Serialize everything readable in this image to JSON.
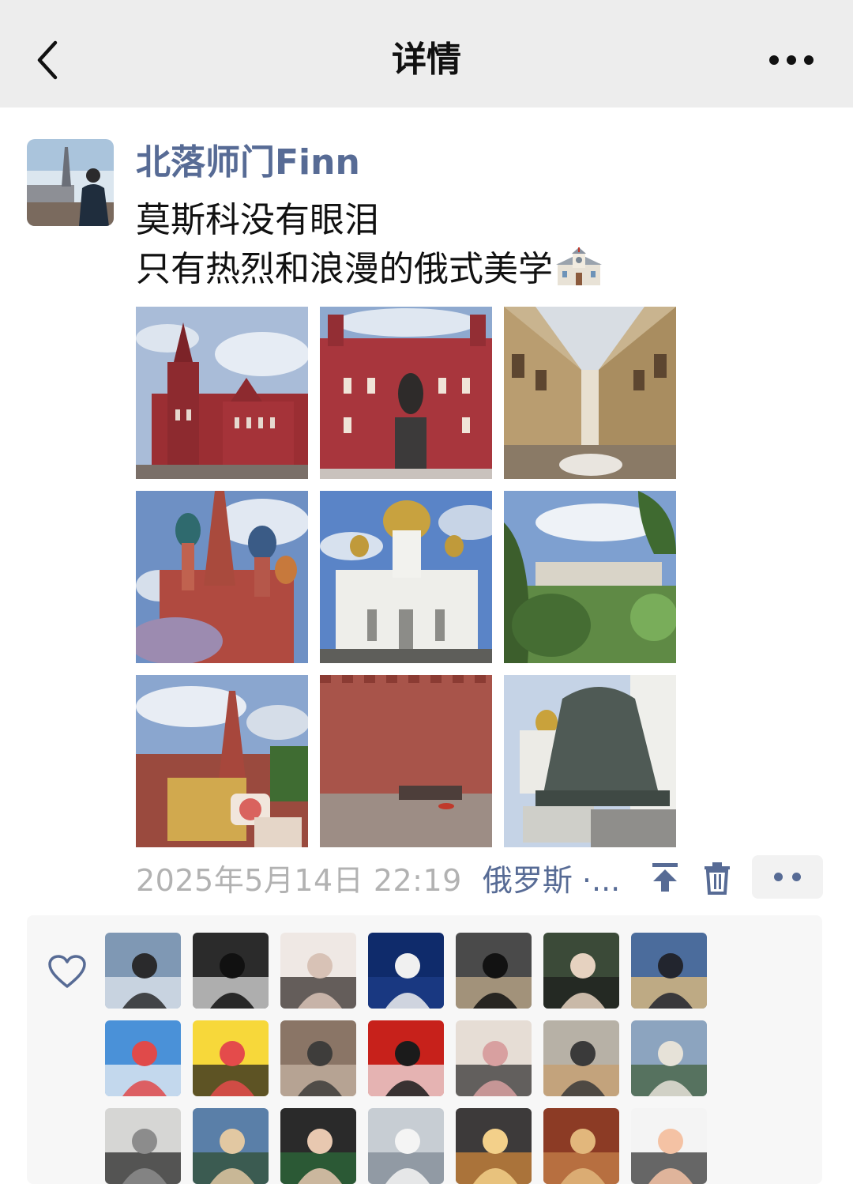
{
  "header": {
    "title": "详情"
  },
  "post": {
    "author": "北落师门Finn",
    "text": "莫斯科没有眼泪\n只有热烈和浪漫的俄式美学",
    "time": "2025年5月14日 22:19",
    "location": "俄罗斯 ·...",
    "photos": [
      "red-museum-tower",
      "red-museum-statue",
      "gum-arcade",
      "st-basils-cathedral",
      "christ-saviour-cathedral",
      "garden-view",
      "kremlin-tower-card",
      "kremlin-wall",
      "tsar-bell"
    ]
  },
  "likes": {
    "icon": "heart-icon",
    "avatars": [
      "avatar-sea-man",
      "avatar-bw-art",
      "avatar-girl-dark",
      "avatar-night-boy",
      "avatar-boy-jacket",
      "avatar-boy-black",
      "avatar-sunset-girl",
      "avatar-cartoon-beach",
      "avatar-pikachu",
      "avatar-cat",
      "avatar-red-wall",
      "avatar-kid",
      "avatar-pyramid",
      "avatar-bench-tree",
      "avatar-portrait-bw",
      "avatar-palms",
      "avatar-girl-food",
      "avatar-ice",
      "avatar-sunset",
      "avatar-art-pattern",
      "avatar-crayon"
    ]
  },
  "colors": {
    "link": "#576b95",
    "meta": "#b2b2b2",
    "topbar": "#ededed"
  }
}
